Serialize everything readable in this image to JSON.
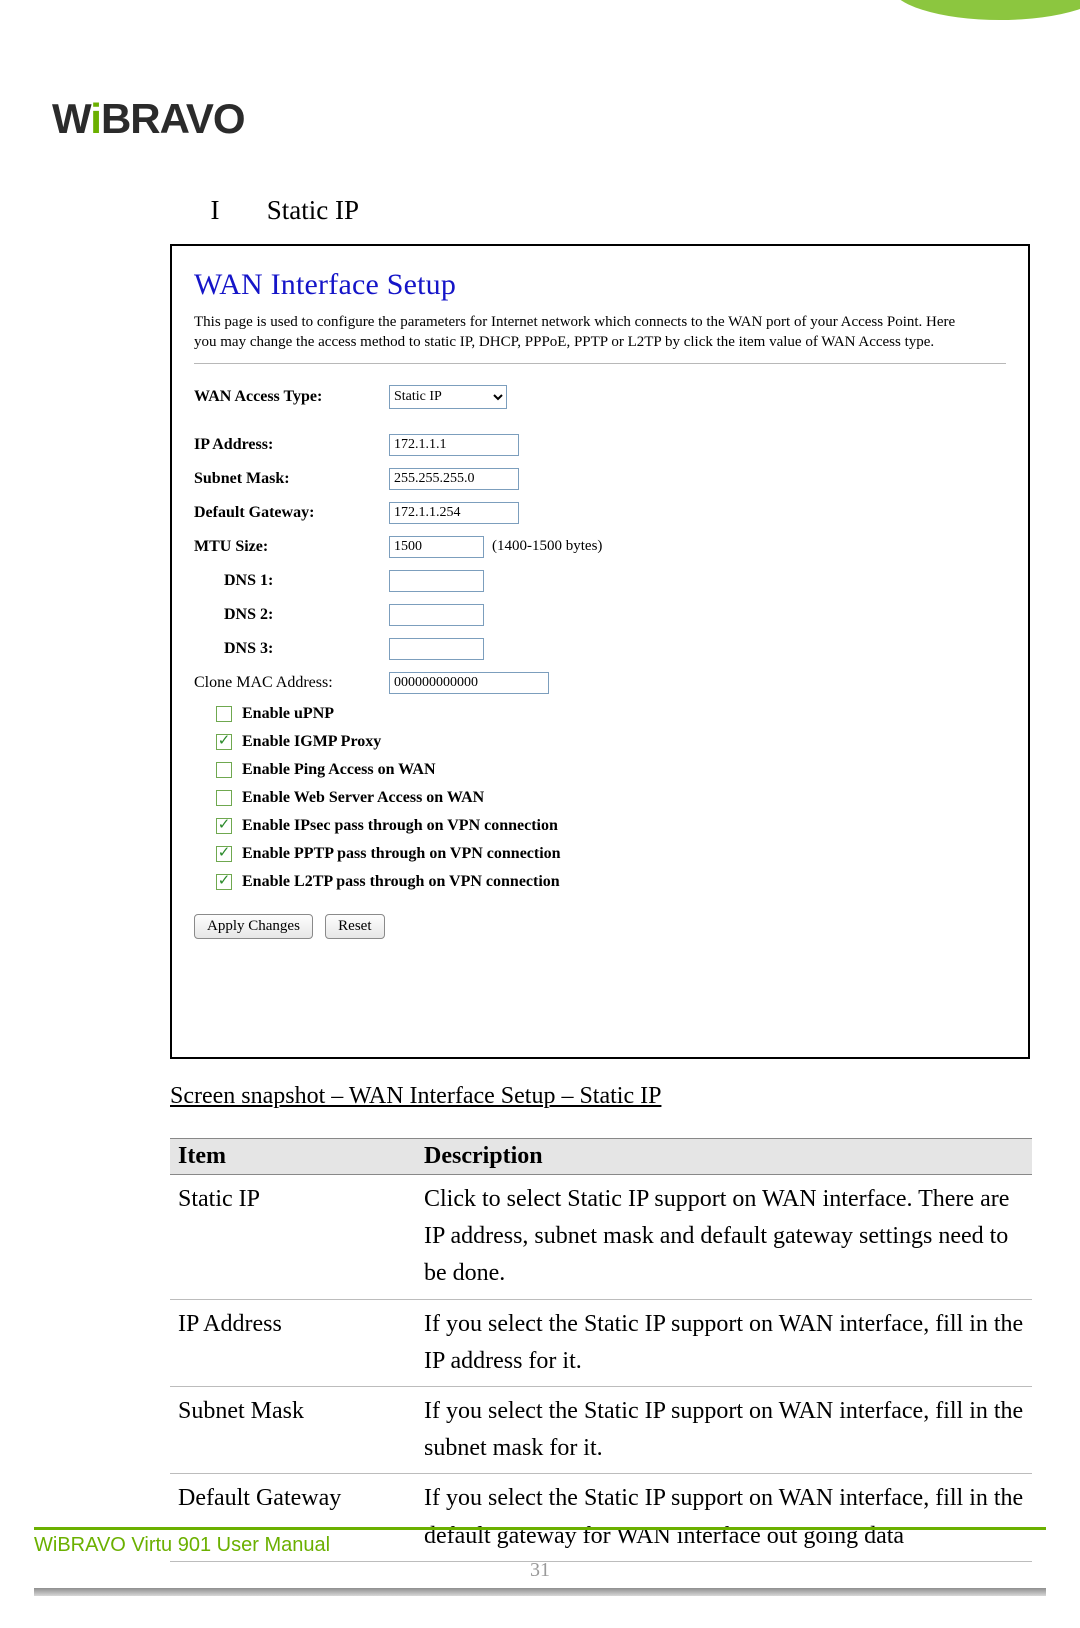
{
  "logo": {
    "w": "W",
    "i": "i",
    "rest": "BRAVO"
  },
  "section": {
    "roman": "I",
    "title": "Static IP"
  },
  "shot": {
    "title": "WAN Interface Setup",
    "desc": "This page is used to configure the parameters for Internet network which connects to the WAN port of your Access Point. Here you may change the access method to static IP, DHCP, PPPoE, PPTP or L2TP by click the item value of WAN Access type.",
    "fields": {
      "wan_access_label": "WAN Access Type:",
      "wan_access_value": "Static IP",
      "ip_label": "IP Address:",
      "ip_value": "172.1.1.1",
      "mask_label": "Subnet Mask:",
      "mask_value": "255.255.255.0",
      "gw_label": "Default Gateway:",
      "gw_value": "172.1.1.254",
      "mtu_label": "MTU Size:",
      "mtu_value": "1500",
      "mtu_hint": "(1400-1500 bytes)",
      "dns1_label": "DNS 1:",
      "dns1_value": "",
      "dns2_label": "DNS 2:",
      "dns2_value": "",
      "dns3_label": "DNS 3:",
      "dns3_value": "",
      "clone_label": "Clone MAC Address:",
      "clone_value": "000000000000"
    },
    "checks": [
      {
        "checked": false,
        "label": "Enable uPNP"
      },
      {
        "checked": true,
        "label": "Enable IGMP Proxy"
      },
      {
        "checked": false,
        "label": "Enable Ping Access on WAN"
      },
      {
        "checked": false,
        "label": "Enable Web Server Access on WAN"
      },
      {
        "checked": true,
        "label": "Enable IPsec pass through on VPN connection"
      },
      {
        "checked": true,
        "label": "Enable PPTP pass through on VPN connection"
      },
      {
        "checked": true,
        "label": "Enable L2TP pass through on VPN connection"
      }
    ],
    "buttons": {
      "apply": "Apply Changes",
      "reset": "Reset"
    }
  },
  "caption": "Screen snapshot – WAN Interface Setup – Static IP",
  "table": {
    "head_item": "Item",
    "head_desc": "Description",
    "rows": [
      {
        "item": "Static IP",
        "desc": "Click to select Static IP support on WAN interface. There are IP address, subnet mask and default gateway settings need to be done."
      },
      {
        "item": "IP Address",
        "desc": "If you select the Static IP support on WAN interface, fill in the IP address for it."
      },
      {
        "item": "Subnet Mask",
        "desc": "If you select the Static IP support on WAN interface, fill in the subnet mask for it."
      },
      {
        "item": "Default Gateway",
        "desc": "If you select the Static IP support on WAN interface, fill in the default gateway for WAN interface out going data"
      }
    ]
  },
  "footer": {
    "manual": "WiBRAVO Virtu 901 User Manual",
    "page": "31"
  }
}
